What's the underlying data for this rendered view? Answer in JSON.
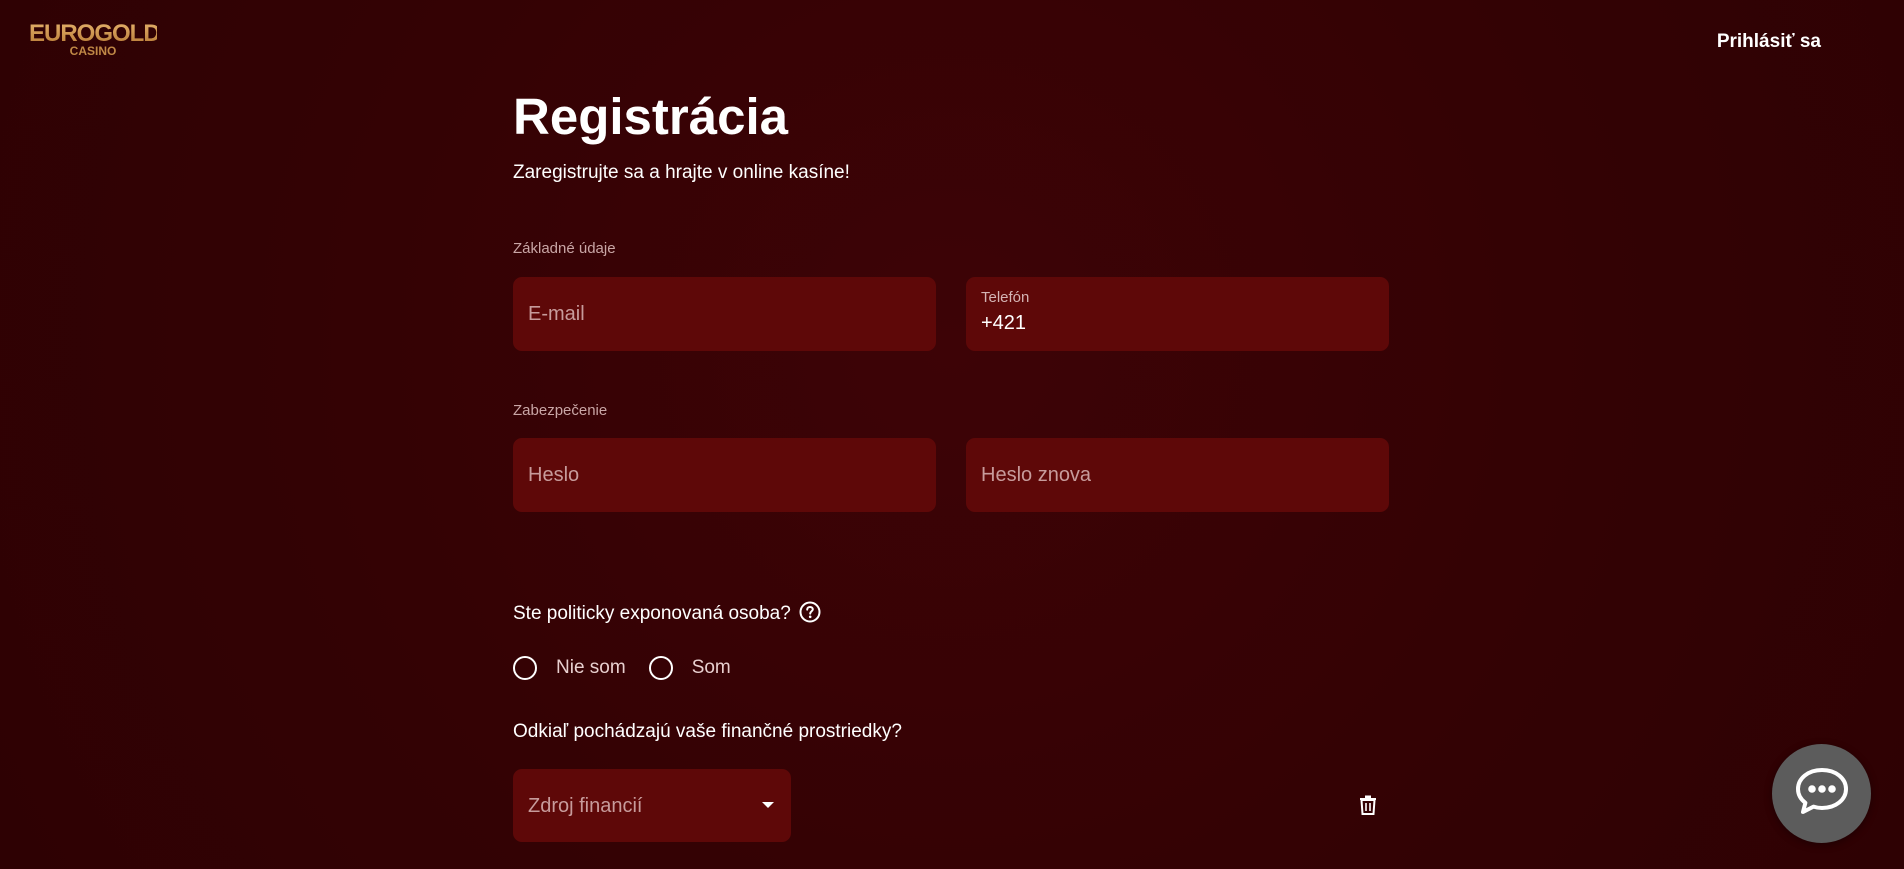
{
  "brand": {
    "logo_line1": "EUROGOLD",
    "logo_line2": "CASINO"
  },
  "header": {
    "login_label": "Prihlásiť sa"
  },
  "page": {
    "title": "Registrácia",
    "subtitle": "Zaregistrujte sa a hrajte v online kasíne!"
  },
  "sections": {
    "basic": {
      "label": "Základné údaje",
      "email_placeholder": "E-mail",
      "phone_label": "Telefón",
      "phone_value": "+421"
    },
    "security": {
      "label": "Zabezpečenie",
      "password_placeholder": "Heslo",
      "password_repeat_placeholder": "Heslo znova"
    }
  },
  "pep": {
    "question": "Ste politicky exponovaná osoba?",
    "options": [
      "Nie som",
      "Som"
    ]
  },
  "funds": {
    "question": "Odkiaľ pochádzajú vaše finančné prostriedky?",
    "select_placeholder": "Zdroj financií"
  },
  "icons": {
    "help": "help-circle-icon",
    "caret": "caret-down-icon",
    "trash": "trash-icon",
    "chat": "chat-bubble-icon"
  },
  "colors": {
    "background": "#360204",
    "field_bg": "#5e0808",
    "logo_gold": "#c9924a",
    "chat_button": "#5c5c5c"
  }
}
